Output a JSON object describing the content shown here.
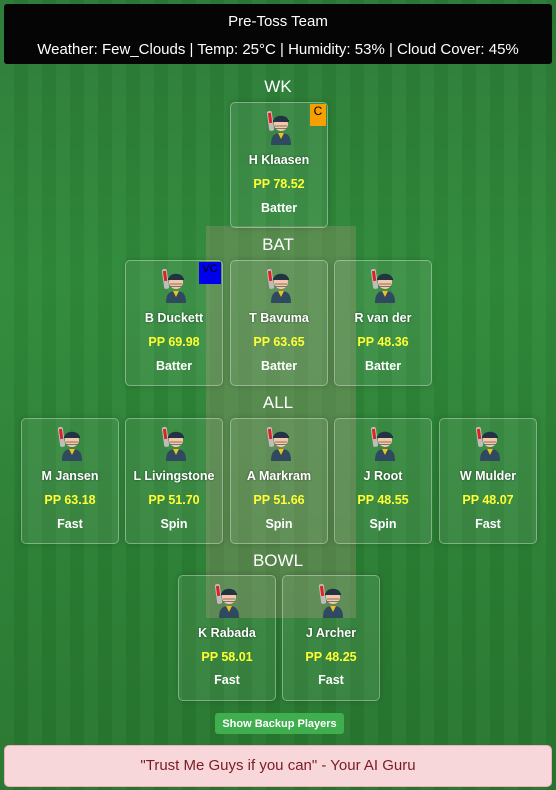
{
  "header": {
    "title": "Pre-Toss Team",
    "weather": "Weather: Few_Clouds | Temp: 25°C | Humidity: 53% | Cloud Cover: 45%"
  },
  "sections": {
    "wk": "WK",
    "bat": "BAT",
    "all": "ALL",
    "bowl": "BOWL"
  },
  "badges": {
    "captain": "C",
    "vice_captain": "VC"
  },
  "players": {
    "wk": [
      {
        "name": "H Klaasen",
        "pp": "PP 78.52",
        "role": "Batter",
        "badge": "C"
      }
    ],
    "bat": [
      {
        "name": "B Duckett",
        "pp": "PP 69.98",
        "role": "Batter",
        "badge": "VC"
      },
      {
        "name": "T Bavuma",
        "pp": "PP 63.65",
        "role": "Batter"
      },
      {
        "name": "R van der",
        "pp": "PP 48.36",
        "role": "Batter"
      }
    ],
    "all": [
      {
        "name": "M Jansen",
        "pp": "PP 63.18",
        "role": "Fast"
      },
      {
        "name": "L Livingstone",
        "pp": "PP 51.70",
        "role": "Spin"
      },
      {
        "name": "A Markram",
        "pp": "PP 51.66",
        "role": "Spin"
      },
      {
        "name": "J Root",
        "pp": "PP 48.55",
        "role": "Spin"
      },
      {
        "name": "W Mulder",
        "pp": "PP 48.07",
        "role": "Fast"
      }
    ],
    "bowl": [
      {
        "name": "K Rabada",
        "pp": "PP 58.01",
        "role": "Fast"
      },
      {
        "name": "J Archer",
        "pp": "PP 48.25",
        "role": "Fast"
      }
    ]
  },
  "avatar_icon": "cricket-player-icon",
  "backup_button": "Show Backup Players",
  "footer": "\"Trust Me Guys if you can\" - Your AI Guru",
  "colors": {
    "pp_value": "#ffff33",
    "captain_badge": "#f5a000",
    "vice_captain_badge": "#0000ee",
    "backup_button": "#3fae4f",
    "footer_bg": "#f8d7da"
  }
}
